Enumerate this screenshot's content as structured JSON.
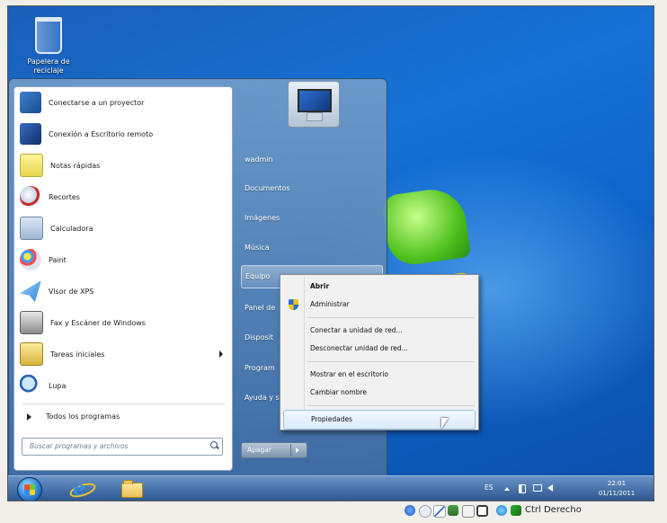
{
  "desktop": {
    "recycle_bin_label": "Papelera de reciclaje"
  },
  "start_menu": {
    "programs": [
      {
        "label": "Conectarse a un proyector",
        "icon": "projector-icon"
      },
      {
        "label": "Conexión a Escritorio remoto",
        "icon": "remote-desktop-icon"
      },
      {
        "label": "Notas rápidas",
        "icon": "sticky-notes-icon"
      },
      {
        "label": "Recortes",
        "icon": "snipping-tool-icon"
      },
      {
        "label": "Calculadora",
        "icon": "calculator-icon"
      },
      {
        "label": "Paint",
        "icon": "paint-icon"
      },
      {
        "label": "Visor de XPS",
        "icon": "xps-viewer-icon"
      },
      {
        "label": "Fax y Escáner de Windows",
        "icon": "fax-scanner-icon"
      },
      {
        "label": "Tareas iniciales",
        "icon": "getting-started-icon"
      },
      {
        "label": "Lupa",
        "icon": "magnifier-icon"
      }
    ],
    "all_programs": "Todos los programas",
    "search_placeholder": "Buscar programas y archivos",
    "right_items": [
      {
        "label": "wadmin"
      },
      {
        "label": "Documentos"
      },
      {
        "label": "Imágenes"
      },
      {
        "label": "Música"
      },
      {
        "label": "Equipo"
      },
      {
        "label": "Panel de"
      },
      {
        "label": "Disposit"
      },
      {
        "label": "Program"
      },
      {
        "label": "Ayuda y s"
      }
    ],
    "shutdown_label": "Apagar"
  },
  "context_menu": {
    "items": [
      {
        "label": "Abrir"
      },
      {
        "label": "Administrar"
      },
      {
        "label": "Conectar a unidad de red..."
      },
      {
        "label": "Desconectar unidad de red..."
      },
      {
        "label": "Mostrar en el escritorio"
      },
      {
        "label": "Cambiar nombre"
      },
      {
        "label": "Propiedades"
      }
    ]
  },
  "taskbar": {
    "language": "ES",
    "time": "22:01",
    "date": "01/11/2011"
  },
  "host_status": {
    "host_key_label": "Ctrl Derecho"
  }
}
